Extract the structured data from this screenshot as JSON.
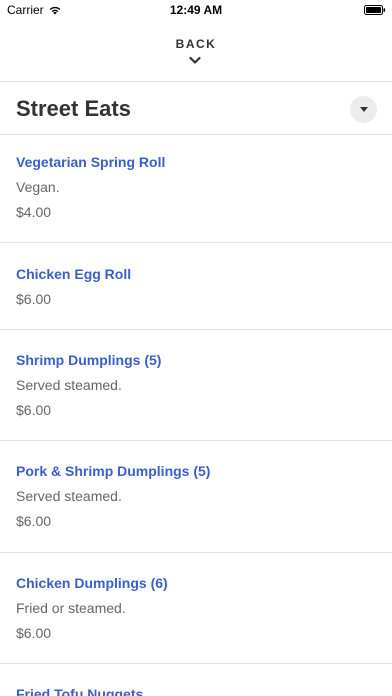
{
  "status_bar": {
    "carrier": "Carrier",
    "time": "12:49 AM"
  },
  "header": {
    "back_label": "BACK"
  },
  "section": {
    "title": "Street Eats"
  },
  "items": [
    {
      "name": "Vegetarian Spring Roll",
      "description": "Vegan.",
      "price": "$4.00"
    },
    {
      "name": "Chicken Egg Roll",
      "description": "",
      "price": "$6.00"
    },
    {
      "name": "Shrimp Dumplings (5)",
      "description": "Served steamed.",
      "price": "$6.00"
    },
    {
      "name": "Pork & Shrimp Dumplings (5)",
      "description": "Served steamed.",
      "price": "$6.00"
    },
    {
      "name": "Chicken Dumplings (6)",
      "description": "Fried or steamed.",
      "price": "$6.00"
    },
    {
      "name": "Fried Tofu Nuggets",
      "description": "",
      "price": ""
    }
  ],
  "colors": {
    "link": "#3b5fc9",
    "divider": "#e2e2e2"
  }
}
